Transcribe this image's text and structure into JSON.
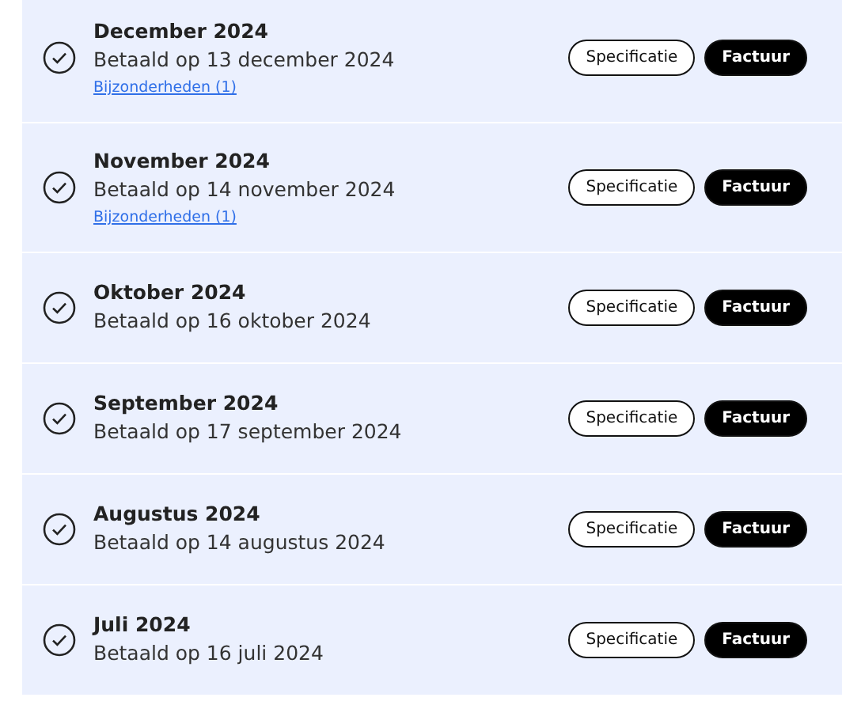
{
  "payments": [
    {
      "title": "December 2024",
      "status": "Betaald op 13 december 2024",
      "paid": true,
      "link": "Bijzonderheden (1)",
      "buttons": [
        "Specificatie",
        "Factuur"
      ]
    },
    {
      "title": "November 2024",
      "status": "Betaald op 14 november 2024",
      "paid": true,
      "link": "Bijzonderheden (1)",
      "buttons": [
        "Specificatie",
        "Factuur"
      ]
    },
    {
      "title": "Oktober 2024",
      "status": "Betaald op 16 oktober 2024",
      "paid": true,
      "buttons": [
        "Specificatie",
        "Factuur"
      ]
    },
    {
      "title": "September 2024",
      "status": "Betaald op 17 september 2024",
      "paid": true,
      "buttons": [
        "Specificatie",
        "Factuur"
      ]
    },
    {
      "title": "Augustus 2024",
      "status": "Betaald op 14 augustus 2024",
      "paid": true,
      "buttons": [
        "Specificatie",
        "Factuur"
      ]
    },
    {
      "title": "Juli 2024",
      "status": "Betaald op 16 juli 2024",
      "paid": true,
      "buttons": [
        "Specificatie",
        "Factuur"
      ]
    }
  ]
}
